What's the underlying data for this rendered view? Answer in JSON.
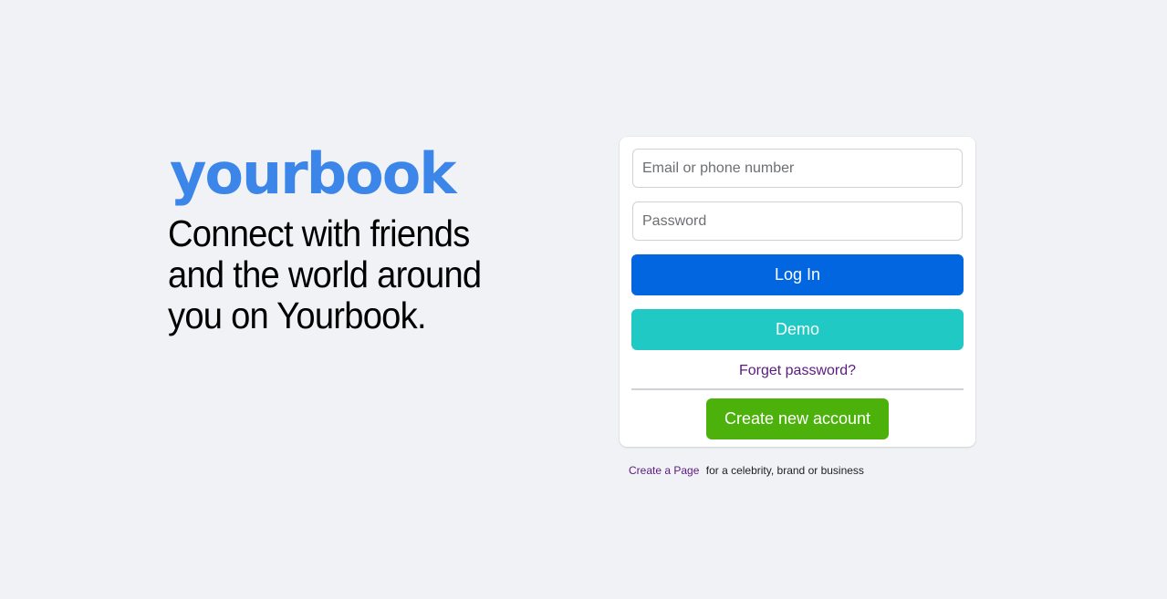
{
  "brand": {
    "logo": "yourbook",
    "tagline": "Connect with friends and the world around you on Yourbook."
  },
  "login_form": {
    "email_placeholder": "Email or phone number",
    "password_placeholder": "Password",
    "login_label": "Log In",
    "demo_label": "Demo",
    "forgot_label": "Forget password?",
    "create_account_label": "Create new account"
  },
  "footer": {
    "create_page_link": "Create a Page",
    "create_page_suffix": "for a celebrity, brand or business"
  },
  "colors": {
    "background": "#f0f2f5",
    "brand": "#3b86e8",
    "login_button": "#0266e1",
    "demo_button": "#20c9c4",
    "create_button": "#4db10c",
    "link": "#5b1a80"
  }
}
